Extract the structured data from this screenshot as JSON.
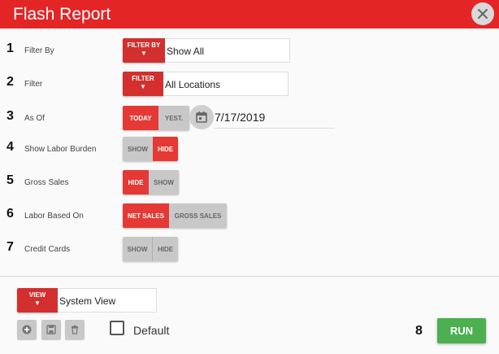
{
  "header": {
    "title": "Flash Report",
    "close_icon": "close-icon"
  },
  "colors": {
    "header_red": "#e32526",
    "toggle_on": "#e53935",
    "toggle_off": "#c8c8c8",
    "run_green": "#4caf50"
  },
  "rows": [
    {
      "num": "1",
      "label": "Filter By",
      "button": "FILTER BY",
      "arrow": "▼",
      "value": "Show All"
    },
    {
      "num": "2",
      "label": "Filter",
      "button": "FILTER",
      "arrow": "▼",
      "value": "All Locations"
    },
    {
      "num": "3",
      "label": "As Of",
      "options": [
        "TODAY",
        "YEST."
      ],
      "selected": "TODAY",
      "date": "7/17/2019",
      "calendar_icon": "calendar-icon"
    },
    {
      "num": "4",
      "label": "Show Labor Burden",
      "options": [
        "SHOW",
        "HIDE"
      ],
      "selected": "HIDE"
    },
    {
      "num": "5",
      "label": "Gross Sales",
      "options": [
        "HIDE",
        "SHOW"
      ],
      "selected": "HIDE"
    },
    {
      "num": "6",
      "label": "Labor Based On",
      "options": [
        "NET SALES",
        "GROSS SALES"
      ],
      "selected": "NET SALES"
    },
    {
      "num": "7",
      "label": "Credit Cards",
      "options": [
        "SHOW",
        "HIDE"
      ],
      "selected": ""
    }
  ],
  "footer": {
    "view_button": "VIEW",
    "view_arrow": "▼",
    "view_value": "System View",
    "icons": [
      "add-icon",
      "save-icon",
      "delete-icon"
    ],
    "default_label": "Default",
    "default_checked": false,
    "run_num": "8",
    "run_label": "RUN"
  }
}
